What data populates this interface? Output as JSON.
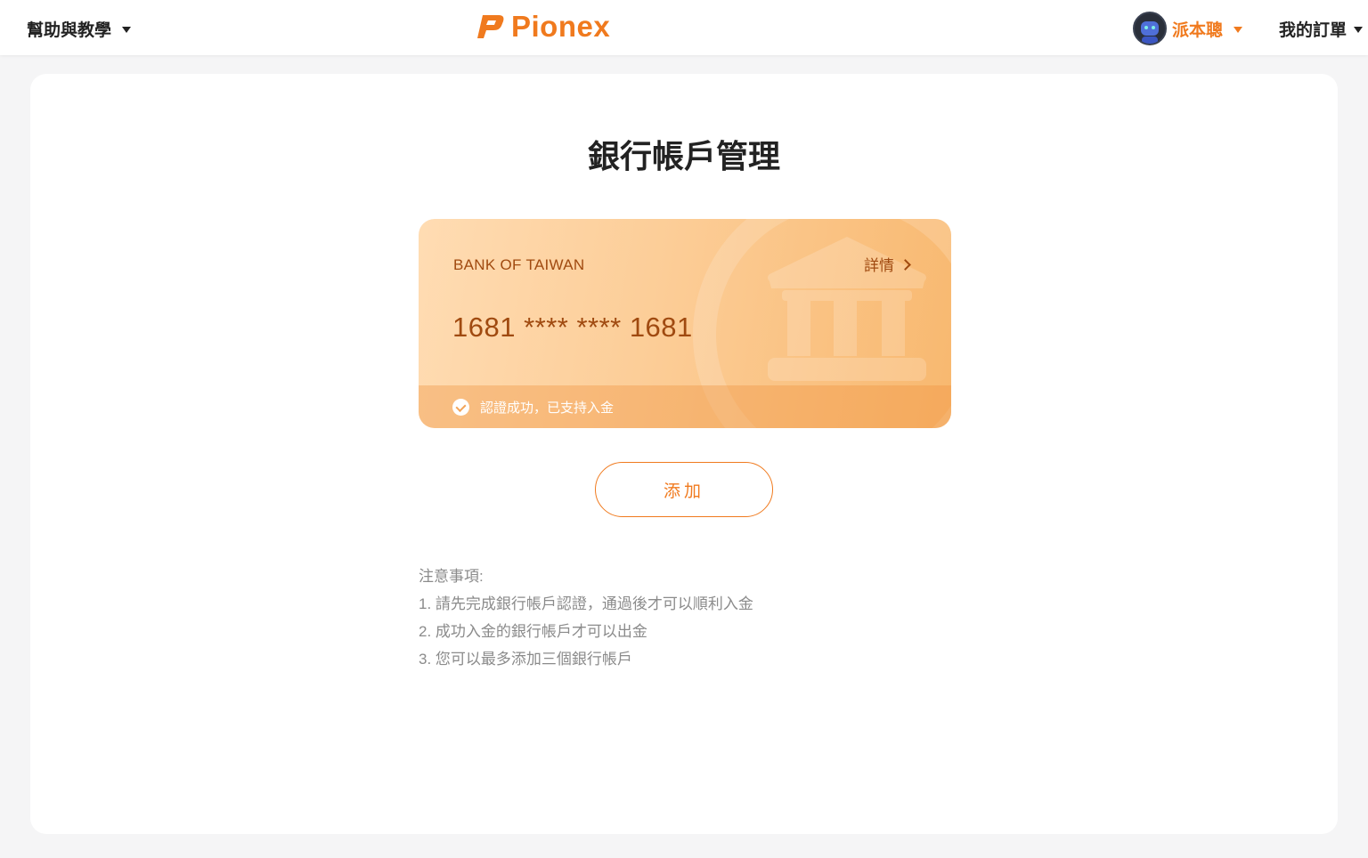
{
  "header": {
    "help_label": "幫助與教學",
    "logo_text": "Pionex",
    "user_name": "派本聰",
    "orders_label": "我的訂單"
  },
  "main": {
    "title": "銀行帳戶管理",
    "card": {
      "bank_name": "BANK OF TAIWAN",
      "detail_label": "詳情",
      "card_number": "1681 **** **** 1681",
      "verify_text": "認證成功，已支持入金"
    },
    "add_button_label": "添加",
    "notes": {
      "title": "注意事項:",
      "items": [
        "1. 請先完成銀行帳戶認證，通過後才可以順利入金",
        "2. 成功入金的銀行帳戶才可以出金",
        "3. 您可以最多添加三個銀行帳戶"
      ]
    }
  },
  "colors": {
    "accent": "#f07a1e",
    "card_text": "#a04a10",
    "card_gradient_start": "#ffdcb3",
    "card_gradient_end": "#f8b86f"
  },
  "icons": [
    "caret-down-icon",
    "pionex-logo-icon",
    "avatar",
    "bank-building-icon",
    "chevron-right-icon",
    "check-circle-icon"
  ]
}
